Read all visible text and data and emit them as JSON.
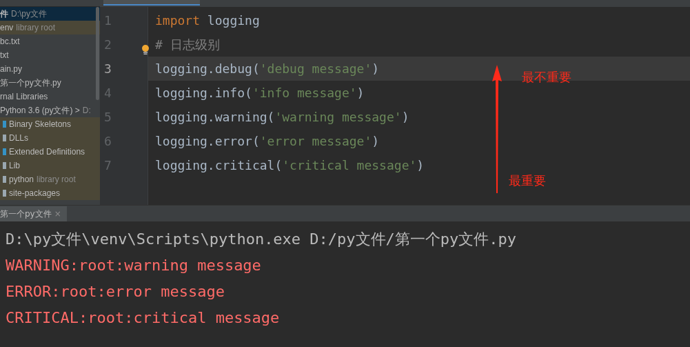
{
  "project_tree": [
    {
      "label": "件",
      "note": "D:\\py文件",
      "selected": true,
      "library": false,
      "children": [
        {
          "label": "env",
          "note": "library root",
          "selected": false,
          "library": true
        },
        {
          "label": "bc.txt",
          "selected": false,
          "library": false
        },
        {
          "label": "txt",
          "selected": false,
          "library": false
        },
        {
          "label": "ain.py",
          "selected": false,
          "library": false
        },
        {
          "label": "第一个py文件.py",
          "selected": false,
          "library": false
        }
      ]
    },
    {
      "label": "rnal Libraries",
      "selected": false,
      "library": false,
      "children": [
        {
          "label": "Python 3.6 (py文件) >",
          "note": "D:",
          "selected": false,
          "library": false,
          "children": [
            {
              "label": "Binary Skeletons",
              "selected": false,
              "library": true,
              "color": "#3592c4"
            },
            {
              "label": "DLLs",
              "selected": false,
              "library": true,
              "color": "#9aa7b0"
            },
            {
              "label": "Extended Definitions",
              "selected": false,
              "library": true,
              "color": "#3592c4"
            },
            {
              "label": "Lib",
              "selected": false,
              "library": true,
              "color": "#9aa7b0"
            },
            {
              "label": "python",
              "note": "library root",
              "selected": false,
              "library": true,
              "color": "#9aa7b0"
            },
            {
              "label": "site-packages",
              "selected": false,
              "library": true,
              "color": "#9aa7b0"
            }
          ]
        }
      ]
    }
  ],
  "editor": {
    "lines": [
      {
        "number": "1",
        "current": false,
        "tokens": [
          {
            "text": "import",
            "kind": "keyword"
          },
          {
            "text": " logging",
            "kind": "plain"
          }
        ]
      },
      {
        "number": "2",
        "current": false,
        "tokens": [
          {
            "text": "# 日志级别",
            "kind": "comment"
          }
        ]
      },
      {
        "number": "3",
        "current": true,
        "tokens": [
          {
            "text": "logging.debug(",
            "kind": "plain"
          },
          {
            "text": "'debug message'",
            "kind": "string"
          },
          {
            "text": ")",
            "kind": "plain"
          }
        ]
      },
      {
        "number": "4",
        "current": false,
        "tokens": [
          {
            "text": "logging.info(",
            "kind": "plain"
          },
          {
            "text": "'info message'",
            "kind": "string"
          },
          {
            "text": ")",
            "kind": "plain"
          }
        ]
      },
      {
        "number": "5",
        "current": false,
        "tokens": [
          {
            "text": "logging.warning(",
            "kind": "plain"
          },
          {
            "text": "'warning message'",
            "kind": "string"
          },
          {
            "text": ")",
            "kind": "plain"
          }
        ]
      },
      {
        "number": "6",
        "current": false,
        "tokens": [
          {
            "text": "logging.error(",
            "kind": "plain"
          },
          {
            "text": "'error message'",
            "kind": "string"
          },
          {
            "text": ")",
            "kind": "plain"
          }
        ]
      },
      {
        "number": "7",
        "current": false,
        "tokens": [
          {
            "text": "logging.critical(",
            "kind": "plain"
          },
          {
            "text": "'critical message'",
            "kind": "string"
          },
          {
            "text": ")",
            "kind": "plain"
          }
        ]
      }
    ]
  },
  "annotations": {
    "top_label": "最不重要",
    "bottom_label": "最重要"
  },
  "run_panel": {
    "tab": {
      "label": "第一个py文件",
      "close": "×"
    },
    "output": [
      {
        "text": "D:\\py文件\\venv\\Scripts\\python.exe D:/py文件/第一个py文件.py",
        "kind": "command"
      },
      {
        "text": "WARNING:root:warning message",
        "kind": "error"
      },
      {
        "text": "ERROR:root:error message",
        "kind": "error"
      },
      {
        "text": "CRITICAL:root:critical message",
        "kind": "error"
      }
    ]
  }
}
